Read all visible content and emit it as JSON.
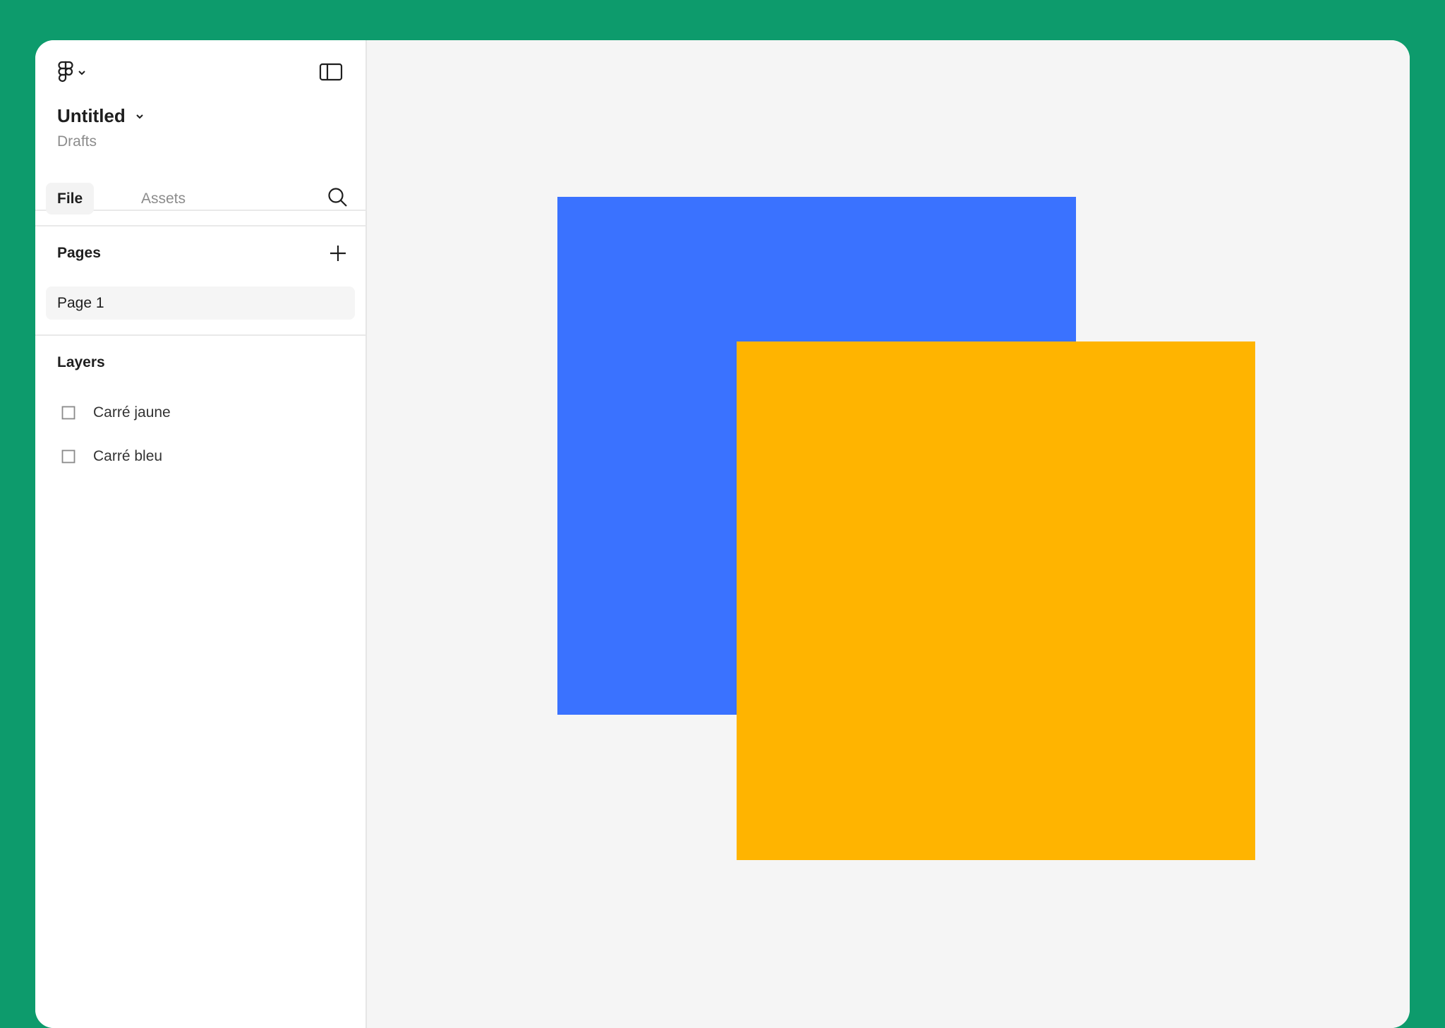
{
  "app": {
    "file_name": "Untitled",
    "location": "Drafts"
  },
  "icons": {
    "logo": "figma-logo-icon",
    "logo_menu": "chevron-down-icon",
    "panel_toggle": "sidebar-toggle-icon",
    "title_menu": "chevron-down-icon",
    "search": "search-icon",
    "add_page": "plus-icon",
    "layer": "rectangle-icon"
  },
  "tabs": {
    "file": "File",
    "assets": "Assets"
  },
  "pages": {
    "title": "Pages",
    "items": [
      {
        "label": "Page 1",
        "selected": true
      }
    ]
  },
  "layers": {
    "title": "Layers",
    "items": [
      {
        "label": "Carré jaune"
      },
      {
        "label": "Carré bleu"
      }
    ]
  },
  "canvas": {
    "shapes": [
      {
        "layer": "Carré bleu",
        "color": "#3a72ff"
      },
      {
        "layer": "Carré jaune",
        "color": "#ffb400"
      }
    ]
  },
  "colors": {
    "desktop_background": "#0d9b6c",
    "canvas_background": "#f5f5f5"
  }
}
